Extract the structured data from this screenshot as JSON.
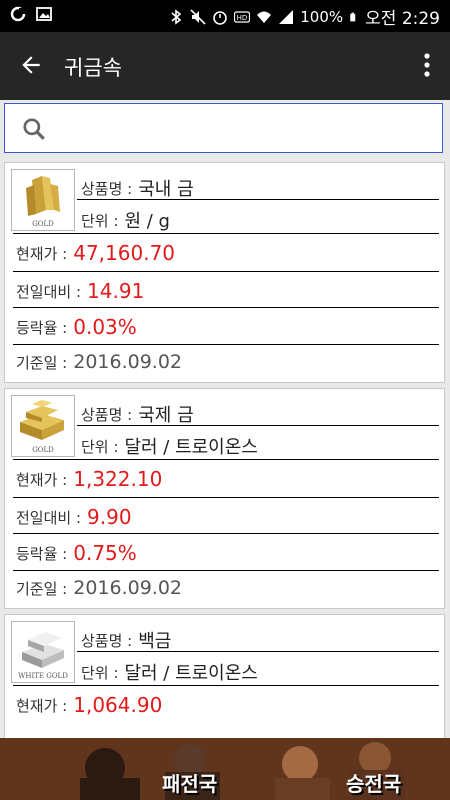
{
  "status": {
    "battery": "100%",
    "time": "오전 2:29"
  },
  "appbar": {
    "title": "귀금속"
  },
  "search": {
    "placeholder": ""
  },
  "labels": {
    "name": "상품명 :",
    "unit": "단위 :",
    "price": "현재가 :",
    "change": "전일대비 :",
    "rate": "등락율 :",
    "date": "기준일 :"
  },
  "items": [
    {
      "thumb_caption": "GOLD",
      "name": "국내 금",
      "unit": "원 / g",
      "price": "47,160.70",
      "change": "14.91",
      "rate": "0.03%",
      "date": "2016.09.02"
    },
    {
      "thumb_caption": "GOLD",
      "name": "국제 금",
      "unit": "달러 / 트로이온스",
      "price": "1,322.10",
      "change": "9.90",
      "rate": "0.75%",
      "date": "2016.09.02"
    },
    {
      "thumb_caption": "WHITE GOLD",
      "name": "백금",
      "unit": "달러 / 트로이온스",
      "price": "1,064.90"
    }
  ],
  "ad": {
    "text_left": "패전국",
    "text_right": "승전국"
  }
}
